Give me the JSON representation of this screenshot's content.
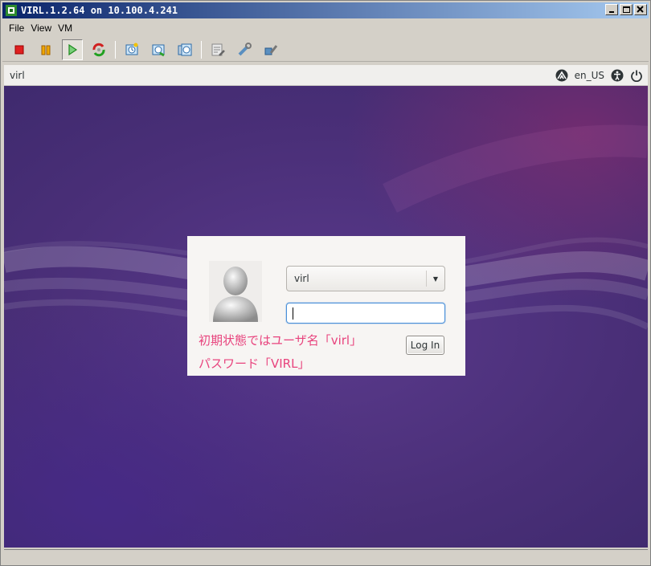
{
  "window": {
    "title": "VIRL.1.2.64 on 10.100.4.241",
    "controls": [
      "minimize",
      "maximize",
      "close"
    ]
  },
  "menu": {
    "items": [
      {
        "label": "File"
      },
      {
        "label": "View"
      },
      {
        "label": "VM"
      }
    ]
  },
  "toolbar": {
    "buttons": [
      {
        "icon": "stop-icon",
        "color": "#e02020"
      },
      {
        "icon": "pause-icon",
        "color": "#e8a000"
      },
      {
        "icon": "play-icon",
        "color": "#2ea02e",
        "pressed": true
      },
      {
        "icon": "reset-icon"
      },
      {
        "icon": "snapshot-icon"
      },
      {
        "icon": "revert-snapshot-icon"
      },
      {
        "icon": "manage-snapshots-icon"
      },
      {
        "icon": "settings-icon"
      },
      {
        "icon": "tools-icon"
      },
      {
        "icon": "integration-icon"
      }
    ]
  },
  "guest_bar": {
    "hostname": "virl",
    "language": "en_US",
    "icons": [
      "network-icon",
      "accessibility-icon",
      "power-icon"
    ]
  },
  "login": {
    "username_selected": "virl",
    "password_value": "",
    "login_button": "Log In",
    "annotation_line1": "初期状態ではユーザ名「virl」",
    "annotation_line2": "パスワード「VIRL」"
  },
  "colors": {
    "annotation": "#e8437d",
    "desktop": "#4a2f78",
    "focus": "#4a90d9"
  }
}
